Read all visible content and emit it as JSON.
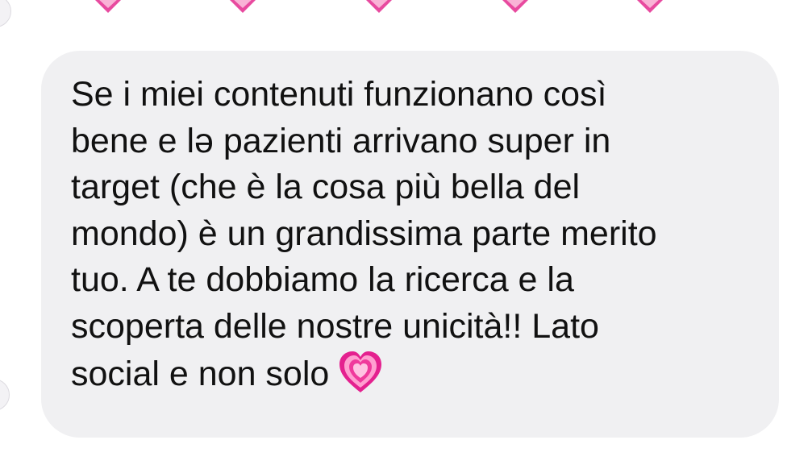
{
  "colors": {
    "background": "#ffffff",
    "bubble": "#f0f0f2",
    "text": "#111111",
    "heart_pink": "#e4218f",
    "heart_light": "#ff9fd0"
  },
  "top_reactions": {
    "icon": "pink-heart-icon",
    "count_visible": 5
  },
  "message": {
    "lines": [
      "Se i miei contenuti funzionano così",
      "bene e lə pazienti arrivano super in",
      "target (che è la cosa più bella del",
      "mondo) è un grandissima parte merito",
      "tuo. A te dobbiamo la ricerca e la",
      "scoperta delle nostre unicità!! Lato",
      "social e non solo"
    ],
    "trailing_emoji": "growing-heart-icon"
  }
}
